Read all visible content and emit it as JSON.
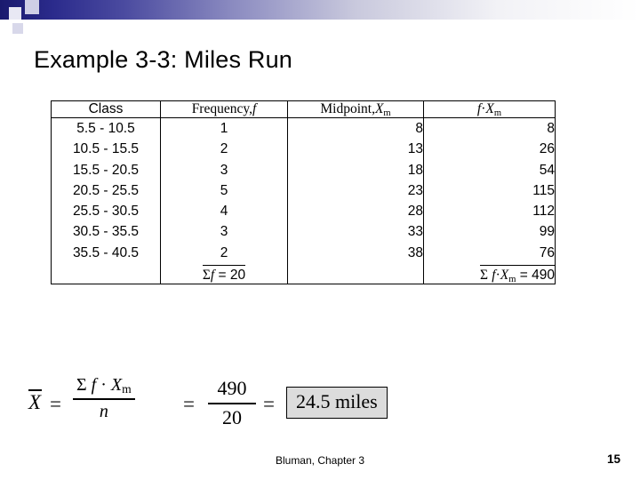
{
  "slide": {
    "title": "Example 3-3: Miles Run",
    "footer": "Bluman, Chapter 3",
    "number": "15"
  },
  "table": {
    "headers": {
      "class": "Class",
      "frequency_prefix": "Frequency,",
      "frequency_symbol": "f",
      "midpoint_prefix": "Midpoint,",
      "midpoint_symbol": "X",
      "midpoint_subscript": "m",
      "product_symbol_f": "f",
      "product_dot": "·",
      "product_symbol_x": "X",
      "product_subscript": "m"
    },
    "rows": [
      {
        "class": "5.5 - 10.5",
        "frequency": "1",
        "midpoint": "8",
        "product": "8"
      },
      {
        "class": "10.5 - 15.5",
        "frequency": "2",
        "midpoint": "13",
        "product": "26"
      },
      {
        "class": "15.5 - 20.5",
        "frequency": "3",
        "midpoint": "18",
        "product": "54"
      },
      {
        "class": "20.5 - 25.5",
        "frequency": "5",
        "midpoint": "23",
        "product": "115"
      },
      {
        "class": "25.5 - 30.5",
        "frequency": "4",
        "midpoint": "28",
        "product": "112"
      },
      {
        "class": "30.5 - 35.5",
        "frequency": "3",
        "midpoint": "33",
        "product": "99"
      },
      {
        "class": "35.5 - 40.5",
        "frequency": "2",
        "midpoint": "38",
        "product": "76"
      }
    ],
    "totals": {
      "frequency_sigma": "Σ",
      "frequency_var": "f",
      "frequency_equals": "= 20",
      "product_sigma": "Σ",
      "product_f": "f",
      "product_dot": "·",
      "product_x": "X",
      "product_sub": "m",
      "product_equals": "= 490"
    }
  },
  "formula": {
    "xbar": "X",
    "equals_1": "=",
    "numerator_sigma": "Σ",
    "numerator_f": "f",
    "numerator_dot": "·",
    "numerator_x": "X",
    "numerator_sub": "m",
    "denominator": "n",
    "equals_2": "=",
    "fraction_numerator": "490",
    "fraction_denominator": "20",
    "equals_3": "=",
    "result": "24.5 miles"
  }
}
